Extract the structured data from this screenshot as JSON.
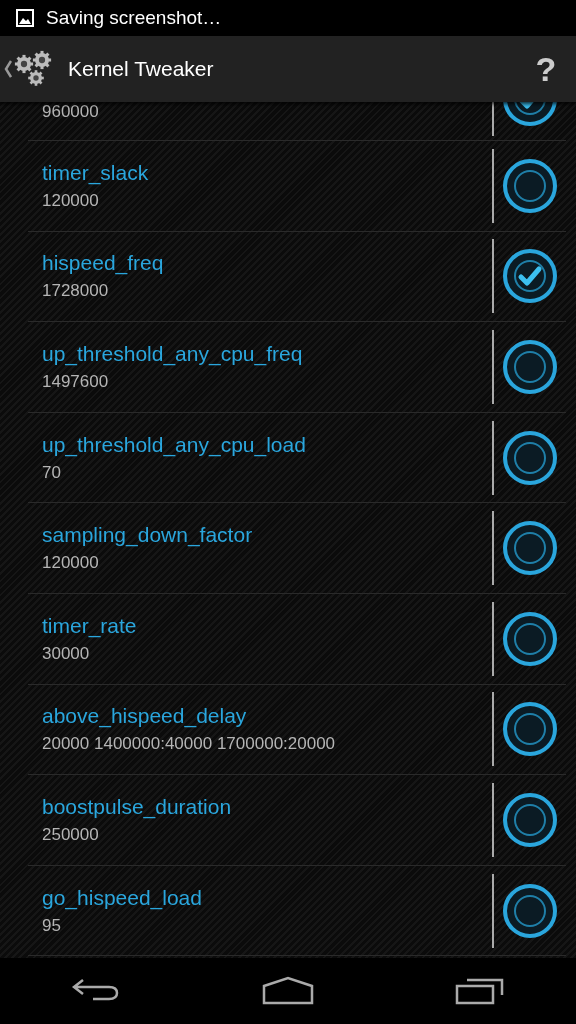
{
  "status_bar": {
    "notification": "Saving screenshot…"
  },
  "action_bar": {
    "title": "Kernel Tweaker",
    "help": "?"
  },
  "settings": [
    {
      "value": "960000",
      "checked": true
    },
    {
      "name": "timer_slack",
      "value": "120000",
      "checked": false
    },
    {
      "name": "hispeed_freq",
      "value": "1728000",
      "checked": true
    },
    {
      "name": "up_threshold_any_cpu_freq",
      "value": "1497600",
      "checked": false
    },
    {
      "name": "up_threshold_any_cpu_load",
      "value": "70",
      "checked": false
    },
    {
      "name": "sampling_down_factor",
      "value": "120000",
      "checked": false
    },
    {
      "name": "timer_rate",
      "value": "30000",
      "checked": false
    },
    {
      "name": "above_hispeed_delay",
      "value": "20000 1400000:40000 1700000:20000",
      "checked": false
    },
    {
      "name": "boostpulse_duration",
      "value": "250000",
      "checked": false
    },
    {
      "name": "go_hispeed_load",
      "value": "95",
      "checked": false
    }
  ]
}
